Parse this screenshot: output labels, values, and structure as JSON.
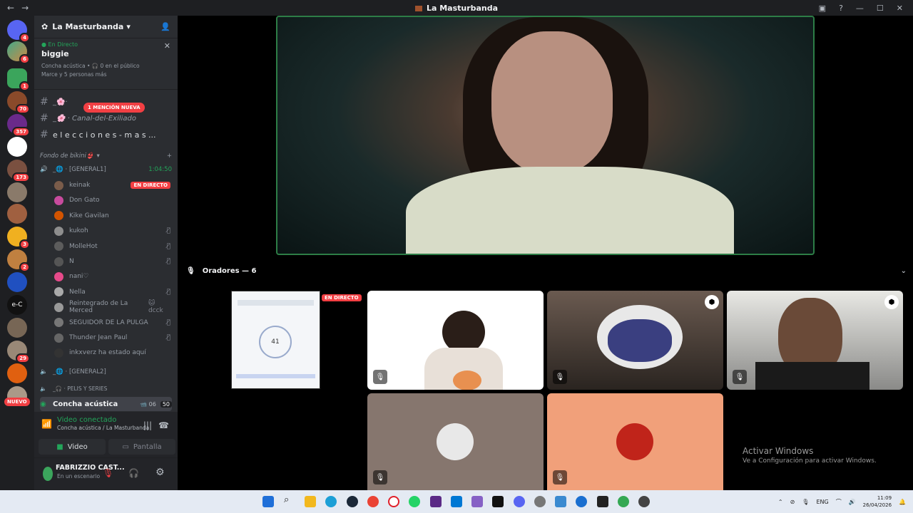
{
  "titlebar": {
    "title": "La Masturbanda",
    "back": "←",
    "forward": "→",
    "inbox_icon": "inbox-icon",
    "help_icon": "help-icon",
    "minimize": "—",
    "maximize": "☐",
    "close": "✕"
  },
  "server": {
    "name": "La Masturbanda"
  },
  "live_panel": {
    "label": "En Directo",
    "host": "biggie",
    "channel": "Concha acústica • 🎧 0 en el público",
    "listeners": "Marce y 5 personas más"
  },
  "mention_badge": "1 MENCIÓN NUEVA",
  "channels": [
    {
      "icon": "#",
      "name": "_🌸·"
    },
    {
      "icon": "#",
      "name": "_🌸 · Canal-del-Exiliado"
    },
    {
      "icon": "#",
      "name": "e l e c c i o n e s - m a s ..."
    }
  ],
  "category": "Fondo de bikini👙",
  "voice_channel_1": {
    "name": "_🌐 · [GENERAL1]",
    "time": "1:04:50"
  },
  "voice_users": [
    {
      "name": "keinak",
      "tag": "EN DIRECTO",
      "color": "#7a5c4a"
    },
    {
      "name": "Don Gato",
      "tag": "",
      "color": "#c84b9e"
    },
    {
      "name": "Kike Gavilan",
      "tag": "",
      "color": "#d35400"
    },
    {
      "name": "kukoh",
      "tag": "",
      "color": "#8e8e8e",
      "muted": "🎙̸"
    },
    {
      "name": "MolleHot",
      "tag": "",
      "color": "#5c5c5c",
      "muted": "🎙̸"
    },
    {
      "name": "N",
      "tag": "",
      "color": "#555",
      "muted": "🎙̸"
    },
    {
      "name": "nani♡",
      "tag": "",
      "color": "#e64a8a"
    },
    {
      "name": "Nella",
      "tag": "",
      "color": "#aaa",
      "muted": "🎙̸"
    },
    {
      "name": "Reintegrado de La Merced",
      "tag": "🐱 dcck",
      "color": "#999"
    },
    {
      "name": "SEGUIDOR DE LA PULGA",
      "tag": "",
      "color": "#777",
      "muted": "🎙̸"
    },
    {
      "name": "Thunder Jean Paul",
      "tag": "",
      "color": "#666",
      "muted": "🎙̸"
    },
    {
      "name": "inkxverz ha estado aquí",
      "tag": "",
      "color": "#333"
    }
  ],
  "voice_channel_2": {
    "name": "_🌐 · [GENERAL2]"
  },
  "voice_channel_3": {
    "name": "_🎧 · PELIS Y SERIES"
  },
  "stage_channel": {
    "name": "Concha acústica",
    "cams": "06",
    "count": "50"
  },
  "voice_status": {
    "title": "Video conectado",
    "sub": "Concha acústica / La Masturbanda",
    "video": "Video",
    "screen": "Pantalla"
  },
  "user": {
    "name": "FABRIZZIO CAST...",
    "status": "En un escenario"
  },
  "speakers": {
    "label": "Oradores — 6"
  },
  "live_tag": "EN DIRECTO",
  "screen_share_number": "41",
  "new_badge": "NUEVO",
  "watermark": {
    "line1": "Activar Windows",
    "line2": "Ve a Configuración para activar Windows."
  },
  "tray": {
    "lang": "ENG",
    "time": "11:09",
    "date": "26/04/2026"
  },
  "guild_badges": [
    "4",
    "6",
    "1",
    "70",
    "357",
    "173",
    "3",
    "2",
    "29"
  ]
}
